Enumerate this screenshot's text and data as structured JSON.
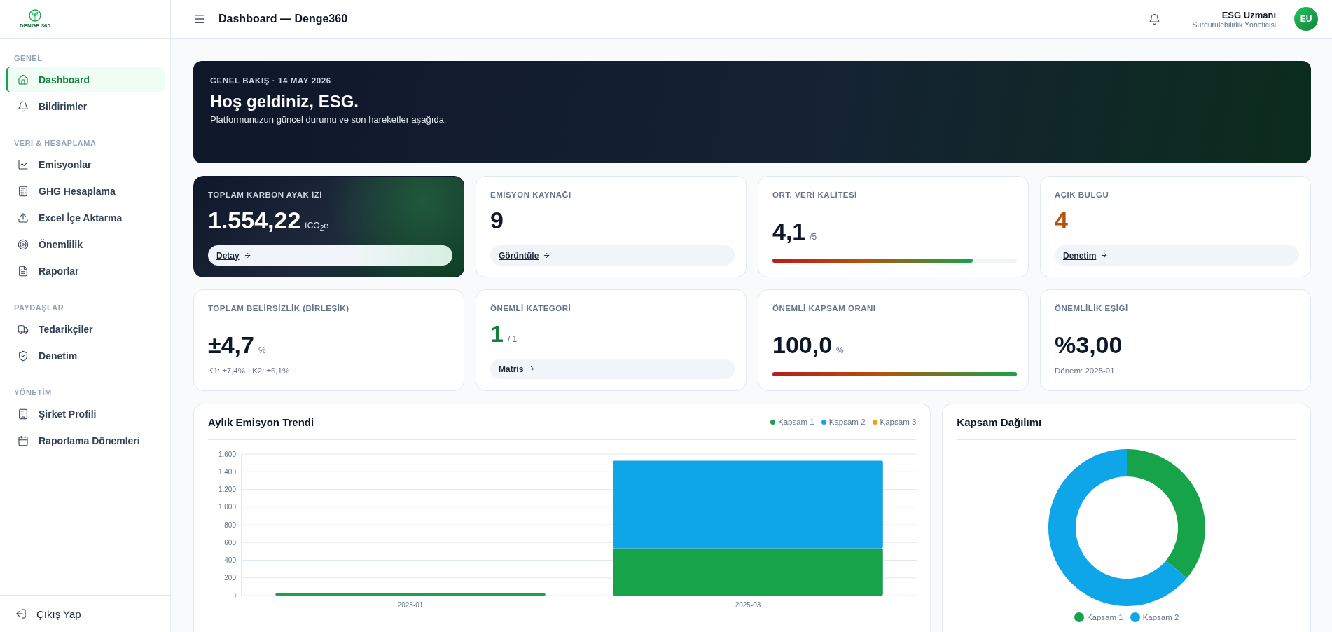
{
  "sidebar": {
    "logo_text": "DENGE 360",
    "sections": [
      {
        "title": "GENEL",
        "items": [
          {
            "label": "Dashboard",
            "selected": true
          },
          {
            "label": "Bildirimler",
            "selected": false
          }
        ]
      },
      {
        "title": "VERİ & HESAPLAMA",
        "items": [
          {
            "label": "Emisyonlar",
            "selected": false
          },
          {
            "label": "GHG Hesaplama",
            "selected": false
          },
          {
            "label": "Excel İçe Aktarma",
            "selected": false
          },
          {
            "label": "Önemlilik",
            "selected": false
          },
          {
            "label": "Raporlar",
            "selected": false
          }
        ]
      },
      {
        "title": "PAYDAŞLAR",
        "items": [
          {
            "label": "Tedarikçiler",
            "selected": false
          },
          {
            "label": "Denetim",
            "selected": false
          }
        ]
      },
      {
        "title": "YÖNETİM",
        "items": [
          {
            "label": "Şirket Profili",
            "selected": false
          },
          {
            "label": "Raporlama Dönemleri",
            "selected": false
          }
        ]
      }
    ],
    "logout": "Çıkış Yap"
  },
  "header": {
    "title": "Dashboard — Denge360",
    "user_name": "ESG Uzmanı",
    "user_role": "Sürdürülebilirlik Yöneticisi",
    "avatar": "EU"
  },
  "banner": {
    "eyebrow": "GENEL BAKIŞ · 14 MAY 2026",
    "title": "Hoş geldiniz, ESG.",
    "subtitle": "Platformunuzun güncel durumu ve son hareketler aşağıda."
  },
  "stats": [
    {
      "kind": "hero",
      "label": "TOPLAM KARBON AYAK İZİ",
      "value": "1.554,22",
      "unit": "tCO$_{2}$e",
      "link": "Detay"
    },
    {
      "kind": "link",
      "color": "#0f172a",
      "label": "EMİSYON KAYNAĞI",
      "value": "9",
      "link": "Görüntüle"
    },
    {
      "kind": "meter",
      "label": "ORT. VERİ KALİTESİ",
      "value": "4,1",
      "unit": "/5",
      "level": 0.82
    },
    {
      "kind": "link",
      "color": "#b45309",
      "label": "AÇIK BULGU",
      "value": "4",
      "link": "Denetim"
    },
    {
      "kind": "note",
      "label": "TOPLAM BELİRSİZLİK (BİRLEŞİK)",
      "value": "±4,7",
      "unit": "%",
      "note": "K1: ±7,4% · K2: ±6,1%"
    },
    {
      "kind": "link",
      "color": "#15803d",
      "label": "ÖNEMLİ KATEGORİ",
      "value": "1",
      "unit": "/ 1",
      "link": "Matris"
    },
    {
      "kind": "meter",
      "label": "ÖNEMLİ KAPSAM ORANI",
      "value": "100,0",
      "unit": "%",
      "level": 1
    },
    {
      "kind": "note",
      "label": "ÖNEMLİLİK EŞİĞİ",
      "value": "%3,00",
      "note": "Dönem: 2025-01"
    }
  ],
  "trend": {
    "title": "Aylık Emisyon Trendi",
    "chart_data": {
      "type": "bar",
      "stacked": true,
      "grid": true,
      "categories": [
        "2025-01",
        "2025-03"
      ],
      "series": [
        {
          "name": "Kapsam 1",
          "color": "#16a34a",
          "values": [
            25,
            535
          ]
        },
        {
          "name": "Kapsam 2",
          "color": "#0ea5e9",
          "values": [
            0,
            990
          ]
        },
        {
          "name": "Kapsam 3",
          "color": "#f59e0b",
          "values": [
            0,
            0
          ]
        }
      ],
      "ylim": [
        0,
        1600
      ],
      "yticks": [
        {
          "value": 0,
          "label": "0"
        },
        {
          "value": 200,
          "label": "200"
        },
        {
          "value": 400,
          "label": "400"
        },
        {
          "value": 600,
          "label": "600"
        },
        {
          "value": 800,
          "label": "800"
        },
        {
          "value": 1000,
          "label": "1.000"
        },
        {
          "value": 1200,
          "label": "1.200"
        },
        {
          "value": 1400,
          "label": "1.400"
        },
        {
          "value": 1600,
          "label": "1.600"
        }
      ]
    }
  },
  "distribution": {
    "title": "Kapsam Dağılımı",
    "chart_data": {
      "type": "donut",
      "categories": [
        "Kapsam 1",
        "Kapsam 2"
      ],
      "values": [
        36.1,
        63.9
      ],
      "colors": [
        "#16a34a",
        "#0ea5e9"
      ]
    }
  }
}
